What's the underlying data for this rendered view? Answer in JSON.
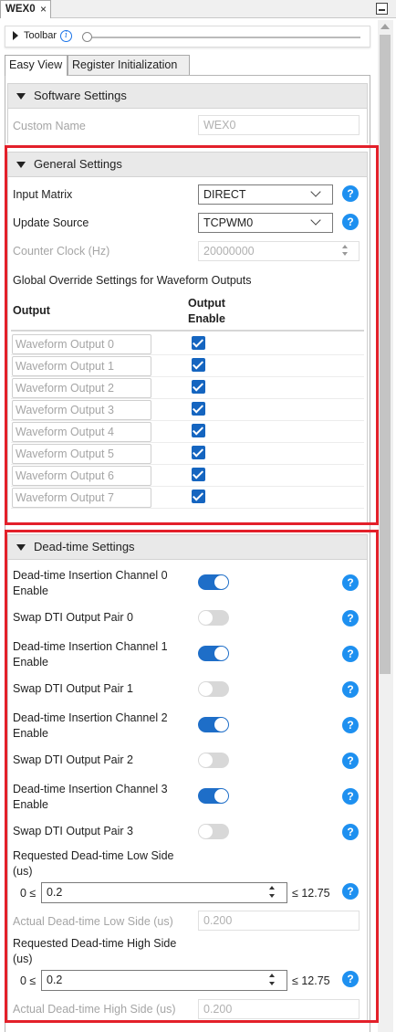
{
  "window": {
    "tab_title": "WEX0",
    "tab_close": "×"
  },
  "toolbar": {
    "label": "Toolbar",
    "info": "i"
  },
  "view_tabs": [
    "Easy View",
    "Register Initialization"
  ],
  "software_settings": {
    "title": "Software Settings",
    "custom_name_label": "Custom Name",
    "custom_name_value": "WEX0"
  },
  "general_settings": {
    "title": "General Settings",
    "input_matrix_label": "Input Matrix",
    "input_matrix_value": "DIRECT",
    "update_source_label": "Update Source",
    "update_source_value": "TCPWM0",
    "counter_clock_label": "Counter Clock (Hz)",
    "counter_clock_value": "20000000",
    "override_title": "Global Override Settings for Waveform Outputs",
    "col_output": "Output",
    "col_enable": "Output Enable",
    "outputs": [
      {
        "name": "Waveform Output 0",
        "enabled": true
      },
      {
        "name": "Waveform Output 1",
        "enabled": true
      },
      {
        "name": "Waveform Output 2",
        "enabled": true
      },
      {
        "name": "Waveform Output 3",
        "enabled": true
      },
      {
        "name": "Waveform Output 4",
        "enabled": true
      },
      {
        "name": "Waveform Output 5",
        "enabled": true
      },
      {
        "name": "Waveform Output 6",
        "enabled": true
      },
      {
        "name": "Waveform Output 7",
        "enabled": true
      }
    ]
  },
  "deadtime_settings": {
    "title": "Dead-time Settings",
    "rows": [
      {
        "label": "Dead-time Insertion Channel 0 Enable",
        "on": true
      },
      {
        "label": "Swap DTI Output Pair 0",
        "on": false
      },
      {
        "label": "Dead-time Insertion Channel 1 Enable",
        "on": true
      },
      {
        "label": "Swap DTI Output Pair 1",
        "on": false
      },
      {
        "label": "Dead-time Insertion Channel 2 Enable",
        "on": true
      },
      {
        "label": "Swap DTI Output Pair 2",
        "on": false
      },
      {
        "label": "Dead-time Insertion Channel 3 Enable",
        "on": true
      },
      {
        "label": "Swap DTI Output Pair 3",
        "on": false
      }
    ],
    "req_low_label": "Requested Dead-time Low Side (us)",
    "req_low_min": "0 ≤",
    "req_low_value": "0.2",
    "req_low_max": "≤ 12.75",
    "act_low_label": "Actual Dead-time Low Side (us)",
    "act_low_value": "0.200",
    "req_high_label": "Requested Dead-time High Side (us)",
    "req_high_min": "0 ≤",
    "req_high_value": "0.2",
    "req_high_max": "≤ 12.75",
    "act_high_label": "Actual Dead-time High Side (us)",
    "act_high_value": "0.200"
  },
  "help_glyph": "?",
  "colors": {
    "highlight": "#e3202a",
    "help": "#1e90f0",
    "toggle_on": "#1e6ec8",
    "checkbox": "#1565c0"
  }
}
